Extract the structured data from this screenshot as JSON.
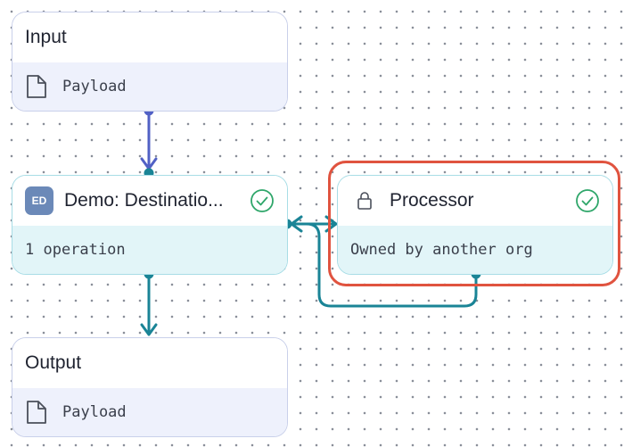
{
  "nodes": {
    "input": {
      "title": "Input",
      "body": "Payload",
      "icon": "document-icon"
    },
    "destination": {
      "badge": "ED",
      "title": "Demo: Destinatio...",
      "body": "1 operation",
      "status_icon": "check-circle-icon"
    },
    "processor": {
      "title": "Processor",
      "body": "Owned by another org",
      "icon": "lock-icon",
      "status_icon": "check-circle-icon"
    },
    "output": {
      "title": "Output",
      "body": "Payload",
      "icon": "document-icon"
    }
  },
  "colors": {
    "edge_input": "#5161c5",
    "edge_teal": "#1a8496",
    "highlight": "#e0533f",
    "check": "#2fa66a",
    "badge": "#6b89b8"
  }
}
